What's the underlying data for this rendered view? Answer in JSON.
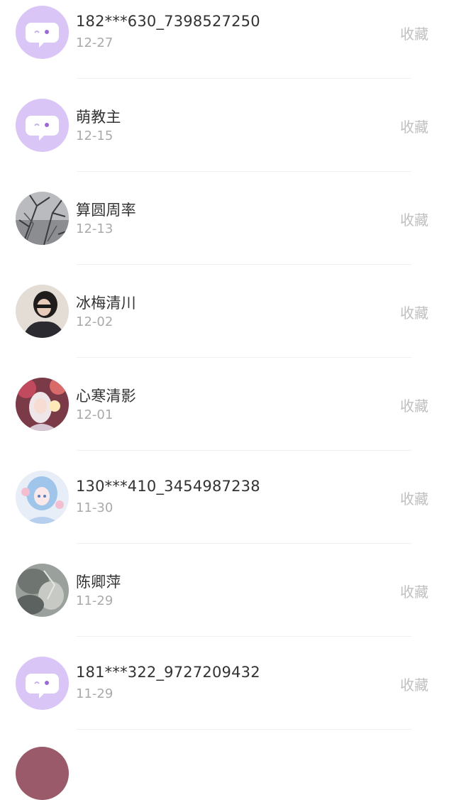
{
  "contacts": [
    {
      "name": "182***630_7398527250",
      "date": "12-27",
      "action": "收藏",
      "avatar": "default-chat-icon"
    },
    {
      "name": "萌教主",
      "date": "12-15",
      "action": "收藏",
      "avatar": "default-chat-icon"
    },
    {
      "name": "算圆周率",
      "date": "12-13",
      "action": "收藏",
      "avatar": "photo-branches"
    },
    {
      "name": "冰梅清川",
      "date": "12-02",
      "action": "收藏",
      "avatar": "photo-person"
    },
    {
      "name": "心寒清影",
      "date": "12-01",
      "action": "收藏",
      "avatar": "photo-anime-girl"
    },
    {
      "name": "130***410_3454987238",
      "date": "11-30",
      "action": "收藏",
      "avatar": "photo-anime-blue"
    },
    {
      "name": "陈卿萍",
      "date": "11-29",
      "action": "收藏",
      "avatar": "photo-grey-scene"
    },
    {
      "name": "181***322_9727209432",
      "date": "11-29",
      "action": "收藏",
      "avatar": "default-chat-icon"
    }
  ],
  "colors": {
    "default_avatar_bg": "#d9c5f6",
    "name_text": "#333333",
    "date_text": "#aaaaaa",
    "action_text": "#bfbfbf"
  }
}
